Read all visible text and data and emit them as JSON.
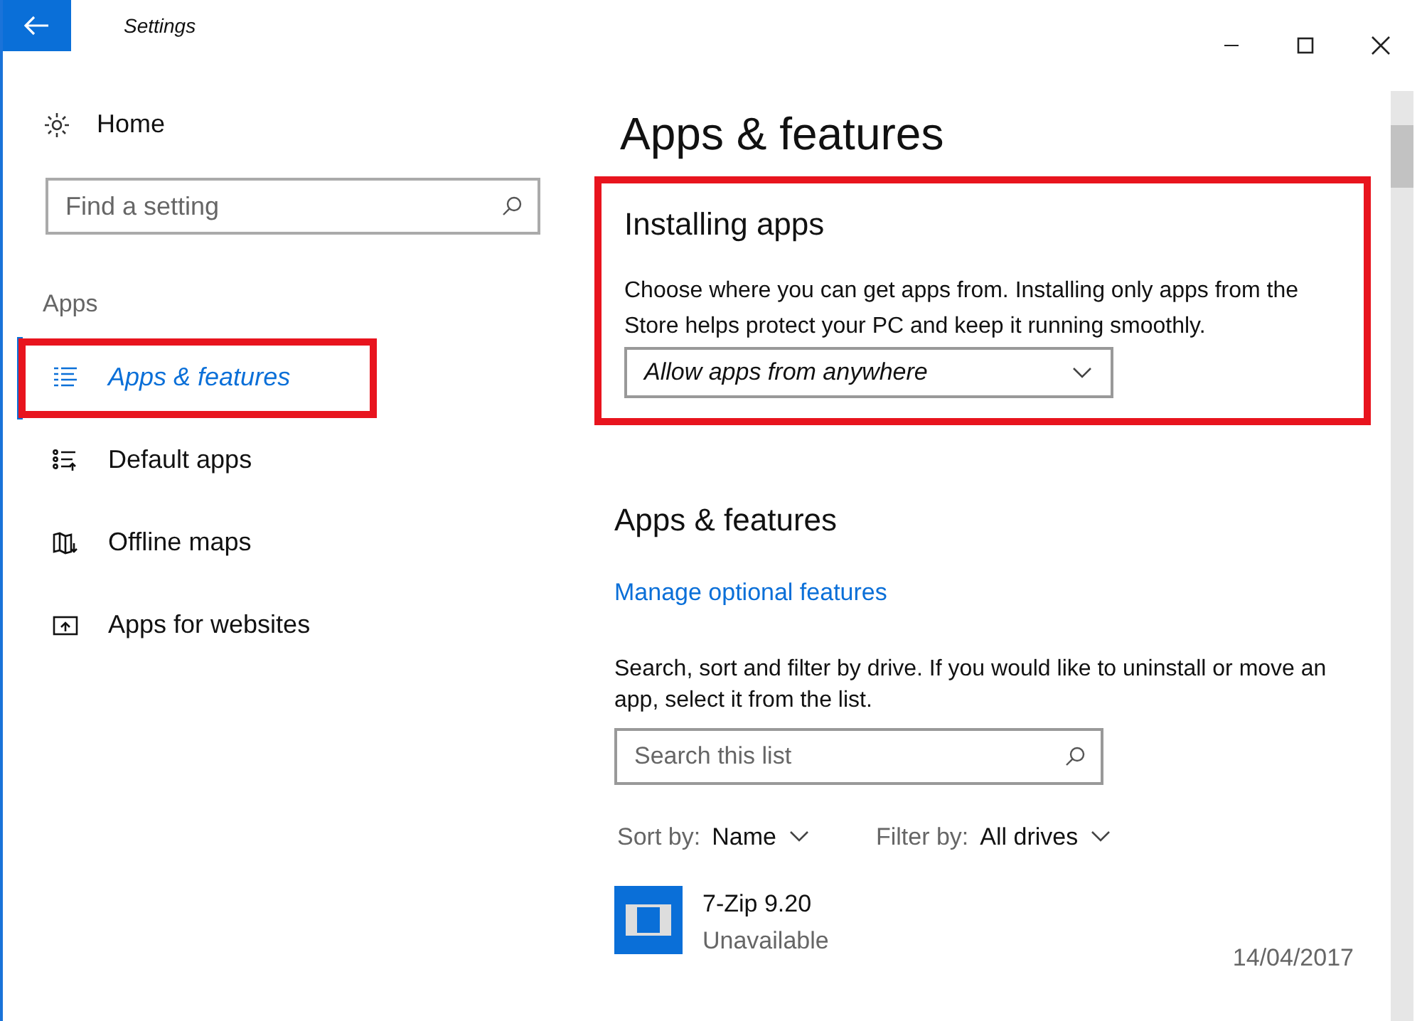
{
  "window": {
    "title": "Settings"
  },
  "sidebar": {
    "home": "Home",
    "search": {
      "placeholder": "Find a setting"
    },
    "section": "Apps",
    "items": [
      {
        "label": "Apps & features",
        "selected": true,
        "highlighted": true
      },
      {
        "label": "Default apps",
        "selected": false,
        "highlighted": false
      },
      {
        "label": "Offline maps",
        "selected": false,
        "highlighted": false
      },
      {
        "label": "Apps for websites",
        "selected": false,
        "highlighted": false
      }
    ]
  },
  "page": {
    "title": "Apps & features",
    "installing": {
      "highlighted": true,
      "heading": "Installing apps",
      "description": "Choose where you can get apps from. Installing only apps from the Store helps protect your PC and keep it running smoothly.",
      "dropdown": "Allow apps from anywhere"
    },
    "features": {
      "heading": "Apps & features",
      "link": "Manage optional features",
      "description": "Search, sort and filter by drive. If you would like to uninstall or move an app, select it from the list.",
      "search": {
        "placeholder": "Search this list"
      },
      "sort": {
        "label": "Sort by:",
        "value": "Name"
      },
      "filter": {
        "label": "Filter by:",
        "value": "All drives"
      },
      "apps": [
        {
          "name": "7-Zip 9.20",
          "status": "Unavailable",
          "date": "14/04/2017"
        }
      ]
    }
  }
}
